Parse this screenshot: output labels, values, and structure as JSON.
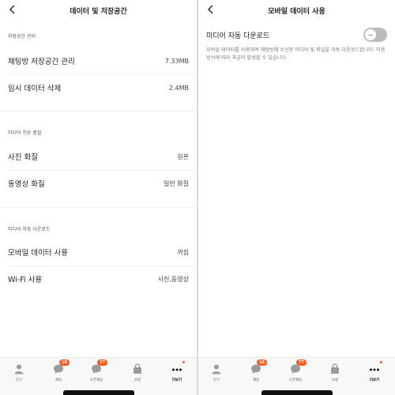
{
  "left": {
    "title": "데이터 및 저장공간",
    "storage": {
      "section": "저장공간 관리",
      "chat_storage_label": "채팅방 저장공간 관리",
      "chat_storage_value": "7.33MB",
      "temp_delete_label": "임시 데이터 삭제",
      "temp_delete_value": "2.4MB"
    },
    "media_quality": {
      "section": "미디어 전송 품질",
      "photo_label": "사진 화질",
      "photo_value": "원본",
      "video_label": "동영상 화질",
      "video_value": "일반 화질"
    },
    "auto_download": {
      "section": "미디어 자동 다운로드",
      "mobile_label": "모바일 데이터 사용",
      "mobile_value": "꺼짐",
      "wifi_label": "Wi-Fi 사용",
      "wifi_value": "사진,동영상"
    }
  },
  "right": {
    "title": "모바일 데이터 사용",
    "toggle_label": "미디어 자동 다운로드",
    "toggle_state": "off",
    "description": "모바일 데이터를 사용하여 채팅방에 수신한 미디어 및 파일을 자동 다운로드합니다. 이용 방식에 따라 과금이 발생할 수 있습니다."
  },
  "tabbar": {
    "tabs": [
      {
        "label": "친구",
        "icon": "person-icon",
        "badge": ""
      },
      {
        "label": "채팅",
        "icon": "chat-bubble-icon",
        "badge": "16"
      },
      {
        "label": "오픈채팅",
        "icon": "open-chat-icon",
        "badge": "77"
      },
      {
        "label": "쇼핑",
        "icon": "shopping-bag-icon",
        "badge": ""
      },
      {
        "label": "더보기",
        "icon": "more-dots-icon",
        "badge": "",
        "active": true
      }
    ]
  },
  "colors": {
    "accent": "#ff5a1f",
    "background": "#ffffff",
    "toggle_off": "#bcbcbc"
  }
}
